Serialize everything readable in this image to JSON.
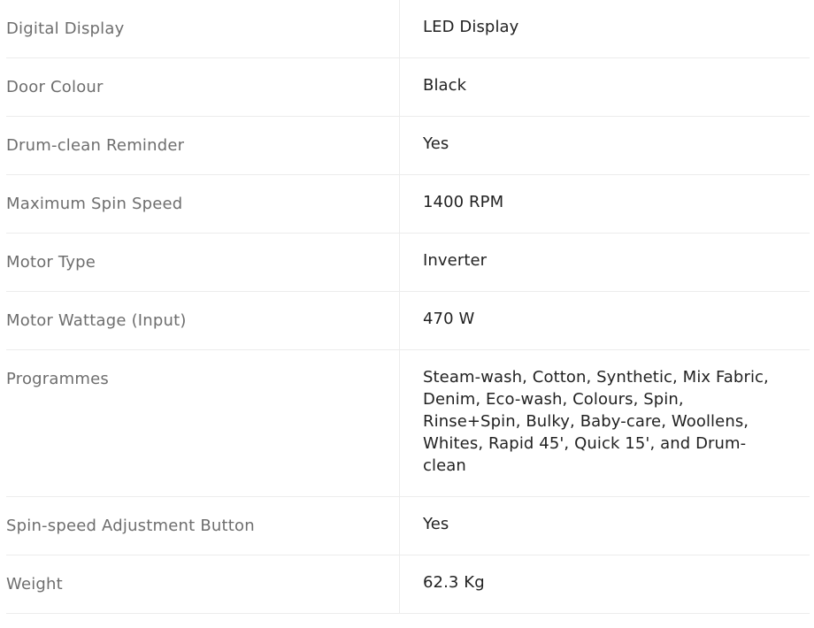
{
  "specs": [
    {
      "label": "Digital Display",
      "value": "LED Display"
    },
    {
      "label": "Door Colour",
      "value": "Black"
    },
    {
      "label": "Drum-clean Reminder",
      "value": "Yes"
    },
    {
      "label": "Maximum Spin Speed",
      "value": "1400 RPM"
    },
    {
      "label": "Motor Type",
      "value": "Inverter"
    },
    {
      "label": "Motor Wattage (Input)",
      "value": "470 W"
    },
    {
      "label": "Programmes",
      "value": "Steam-wash, Cotton, Synthetic, Mix Fabric, Denim, Eco-wash, Colours, Spin, Rinse+Spin, Bulky, Baby-care, Woollens, Whites, Rapid 45', Quick 15', and Drum-clean"
    },
    {
      "label": "Spin-speed Adjustment Button",
      "value": "Yes"
    },
    {
      "label": "Weight",
      "value": "62.3 Kg"
    }
  ]
}
